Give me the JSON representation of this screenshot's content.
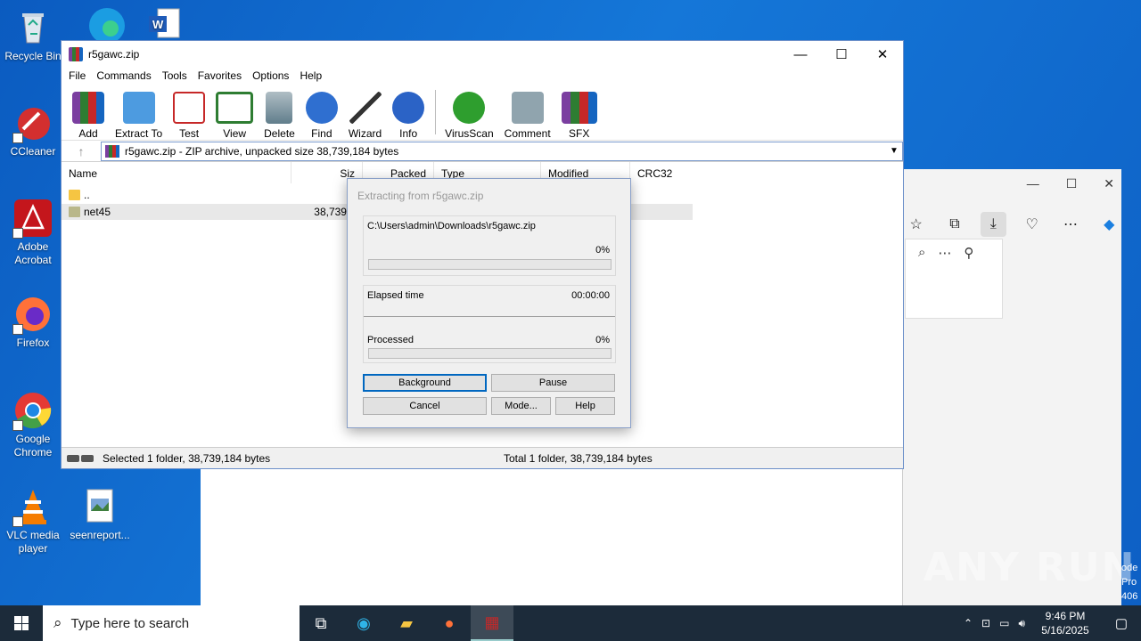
{
  "desktop": {
    "icons": [
      {
        "label": "Recycle Bin",
        "icon": "recycle-bin-icon"
      },
      {
        "label": "CCleaner",
        "icon": "ccleaner-icon"
      },
      {
        "label": "Adobe Acrobat",
        "icon": "adobe-acrobat-icon"
      },
      {
        "label": "Firefox",
        "icon": "firefox-icon"
      },
      {
        "label": "Google Chrome",
        "icon": "chrome-icon"
      },
      {
        "label": "VLC media player",
        "icon": "vlc-icon"
      },
      {
        "label": "seenreport...",
        "icon": "image-file-icon"
      }
    ],
    "watermark": "ANY RUN",
    "edition_text": [
      "ode",
      "Pro",
      "406"
    ]
  },
  "winrar": {
    "title": "r5gawc.zip",
    "menu": [
      "File",
      "Commands",
      "Tools",
      "Favorites",
      "Options",
      "Help"
    ],
    "toolbar": [
      "Add",
      "Extract To",
      "Test",
      "View",
      "Delete",
      "Find",
      "Wizard",
      "Info",
      "VirusScan",
      "Comment",
      "SFX"
    ],
    "path": "r5gawc.zip - ZIP archive, unpacked size 38,739,184 bytes",
    "columns": [
      "Name",
      "Siz",
      "Packed",
      "Type",
      "Modified",
      "CRC32"
    ],
    "rows": [
      {
        "name": "..",
        "size": ""
      },
      {
        "name": "net45",
        "size": "38,739,1"
      }
    ],
    "status_left": "Selected 1 folder, 38,739,184 bytes",
    "status_right": "Total 1 folder, 38,739,184 bytes"
  },
  "dialog": {
    "title": "Extracting from r5gawc.zip",
    "file_path": "C:\\Users\\admin\\Downloads\\r5gawc.zip",
    "file_percent": "0%",
    "elapsed_label": "Elapsed time",
    "elapsed_value": "00:00:00",
    "processed_label": "Processed",
    "processed_percent": "0%",
    "progress_file": 0,
    "progress_total": 0,
    "buttons": {
      "background": "Background",
      "pause": "Pause",
      "cancel": "Cancel",
      "mode": "Mode...",
      "help": "Help"
    }
  },
  "taskbar": {
    "search_placeholder": "Type here to search",
    "time": "9:46 PM",
    "date": "5/16/2025"
  }
}
